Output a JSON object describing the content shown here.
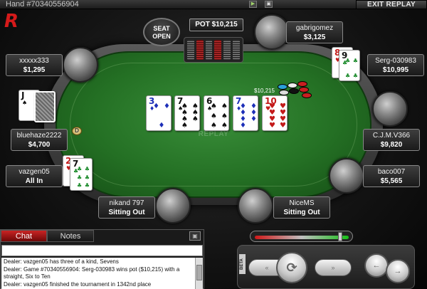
{
  "header": {
    "hand_label": "Hand #70340556904",
    "exit_label": "EXIT REPLAY",
    "logo": "R",
    "play_icon": "play-icon",
    "window_icon": "window-icon"
  },
  "table": {
    "pot_label": "POT $10,215",
    "seat_open": "SEAT OPEN",
    "watermark": "REPLAY",
    "bet_amount": "$10,215",
    "dealer_button": "D",
    "board": [
      {
        "rank": "3",
        "suit": "♦",
        "color": "blue"
      },
      {
        "rank": "7",
        "suit": "♠",
        "color": "black"
      },
      {
        "rank": "6",
        "suit": "♠",
        "color": "black"
      },
      {
        "rank": "7",
        "suit": "♦",
        "color": "blue"
      },
      {
        "rank": "10",
        "suit": "♥",
        "color": "red"
      }
    ]
  },
  "players": [
    {
      "name": "gabrigomez",
      "stack": "$3,125"
    },
    {
      "name": "Serg-030983",
      "stack": "$10,995",
      "cards": [
        {
          "rank": "8",
          "suit": "♥"
        },
        {
          "rank": "9",
          "suit": "♣"
        }
      ]
    },
    {
      "name": "C.J.M.V366",
      "stack": "$9,820"
    },
    {
      "name": "baco007",
      "stack": "$5,565"
    },
    {
      "name": "NiceMS",
      "stack": "Sitting Out"
    },
    {
      "name": "nikand 797",
      "stack": "Sitting Out"
    },
    {
      "name": "vazgen05",
      "stack": "All In",
      "cards": [
        {
          "rank": "2",
          "suit": "♥"
        },
        {
          "rank": "7",
          "suit": "♣"
        }
      ]
    },
    {
      "name": "bluehaze2222",
      "stack": "$4,700",
      "cards": [
        {
          "rank": "J",
          "suit": "♠"
        },
        {
          "rank": "",
          "suit": ""
        }
      ]
    },
    {
      "name": "xxxxx333",
      "stack": "$1,295"
    }
  ],
  "chat": {
    "tab_chat": "Chat",
    "tab_notes": "Notes",
    "input_value": "",
    "log": [
      "Dealer: vazgen05 has three of a kind, Sevens",
      "Dealer: Game #70340556904: Serg-030983 wins pot ($10,215) with a straight, Six to Ten",
      "Dealer: vazgen05 finished the tournament in 1342nd place"
    ]
  },
  "controls": {
    "beta_label": "BETA",
    "speed_level": 0.93,
    "rewind": "«",
    "replay": "⟳",
    "forward": "»",
    "prev": "←",
    "next": "→"
  },
  "colors": {
    "felt": "#247024",
    "accent_red": "#c92424"
  }
}
